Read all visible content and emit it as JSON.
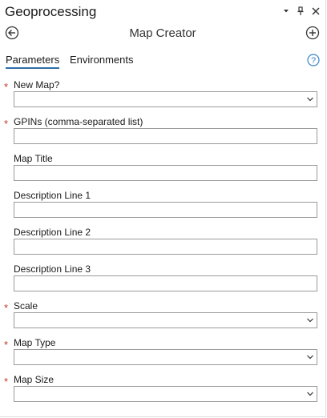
{
  "window": {
    "title": "Geoprocessing",
    "controls": [
      "chevron-down-icon",
      "pin-icon",
      "close-icon"
    ]
  },
  "tool": {
    "title": "Map Creator",
    "back_icon": "back-arrow-icon",
    "add_icon": "add-circle-icon"
  },
  "tabs": [
    {
      "label": "Parameters",
      "active": true
    },
    {
      "label": "Environments",
      "active": false
    }
  ],
  "help_icon": "help-question-icon",
  "parameters": [
    {
      "label": "New Map?",
      "required": true,
      "type": "dropdown",
      "value": ""
    },
    {
      "label": "GPINs (comma-separated list)",
      "required": true,
      "type": "text",
      "value": ""
    },
    {
      "label": "Map Title",
      "required": false,
      "type": "text",
      "value": ""
    },
    {
      "label": "Description Line 1",
      "required": false,
      "type": "text",
      "value": ""
    },
    {
      "label": "Description Line 2",
      "required": false,
      "type": "text",
      "value": ""
    },
    {
      "label": "Description Line 3",
      "required": false,
      "type": "text",
      "value": ""
    },
    {
      "label": "Scale",
      "required": true,
      "type": "dropdown",
      "value": ""
    },
    {
      "label": "Map Type",
      "required": true,
      "type": "dropdown",
      "value": ""
    },
    {
      "label": "Map Size",
      "required": true,
      "type": "dropdown",
      "value": ""
    }
  ],
  "required_marker": "*",
  "colors": {
    "required": "#c0392b",
    "tab_underline": "#2e6fab",
    "help": "#3a86c8",
    "field_border": "#9a9a9a"
  }
}
